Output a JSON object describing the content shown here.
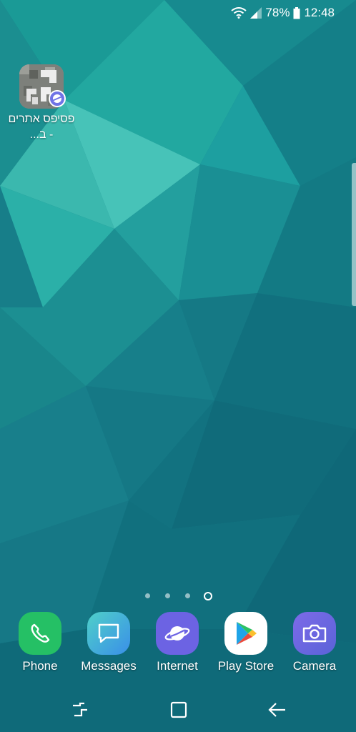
{
  "status_bar": {
    "battery_percent": "78%",
    "time": "12:48",
    "icons": [
      "wifi-icon",
      "signal-icon",
      "battery-icon"
    ]
  },
  "home_shortcut": {
    "label": "פסיפס אתרים - ב...",
    "badge_icon": "internet-badge-icon"
  },
  "page_indicator": {
    "count": 4,
    "current": 4
  },
  "dock": {
    "apps": [
      {
        "label": "Phone",
        "icon": "phone-icon",
        "color": "#25c065"
      },
      {
        "label": "Messages",
        "icon": "messages-icon",
        "color": "#3aa6e6"
      },
      {
        "label": "Internet",
        "icon": "internet-icon",
        "color": "#6c63e3"
      },
      {
        "label": "Play Store",
        "icon": "play-store-icon",
        "color": "#ffffff"
      },
      {
        "label": "Camera",
        "icon": "camera-icon",
        "color": "#6a63de"
      }
    ]
  },
  "nav_bar": {
    "buttons": [
      "recent-apps-icon",
      "home-icon",
      "back-icon"
    ]
  }
}
